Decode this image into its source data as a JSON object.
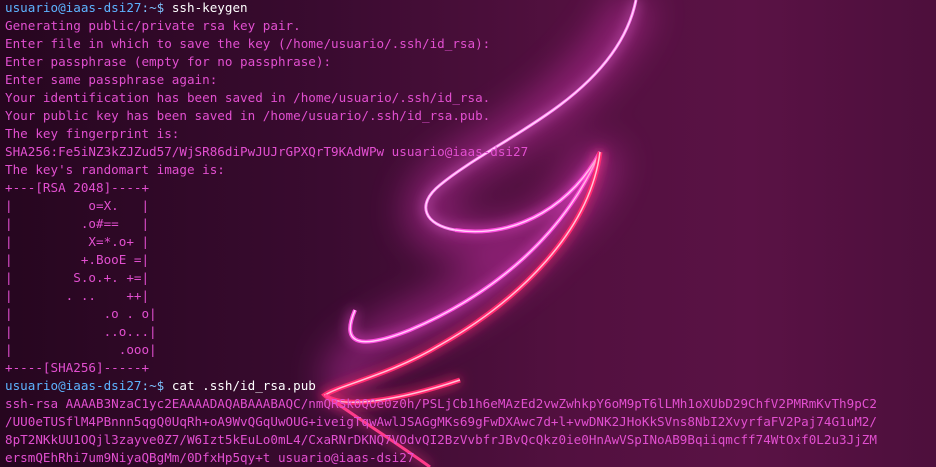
{
  "terminal": {
    "colors": {
      "background": "#3a0b30",
      "text": "#e24fd0",
      "prompt": "#5db3ff",
      "command": "#ffffff",
      "glow": "#ff55e6"
    },
    "session": [
      {
        "kind": "prompt",
        "user": "usuario@iaas-dsi27",
        "path": ":~$",
        "command": " ssh-keygen"
      },
      {
        "kind": "output",
        "text": "Generating public/private rsa key pair."
      },
      {
        "kind": "output",
        "text": "Enter file in which to save the key (/home/usuario/.ssh/id_rsa):"
      },
      {
        "kind": "output",
        "text": "Enter passphrase (empty for no passphrase):"
      },
      {
        "kind": "output",
        "text": "Enter same passphrase again:"
      },
      {
        "kind": "output",
        "text": "Your identification has been saved in /home/usuario/.ssh/id_rsa."
      },
      {
        "kind": "output",
        "text": "Your public key has been saved in /home/usuario/.ssh/id_rsa.pub."
      },
      {
        "kind": "output",
        "text": "The key fingerprint is:"
      },
      {
        "kind": "output",
        "text": "SHA256:Fe5iNZ3kZJZud57/WjSR86diPwJUJrGPXQrT9KAdWPw usuario@iaas-dsi27"
      },
      {
        "kind": "output",
        "text": "The key's randomart image is:"
      },
      {
        "kind": "output",
        "text": "+---[RSA 2048]----+"
      },
      {
        "kind": "output",
        "text": "|          o=X.   |"
      },
      {
        "kind": "output",
        "text": "|         .o#==   |"
      },
      {
        "kind": "output",
        "text": "|          X=*.o+ |"
      },
      {
        "kind": "output",
        "text": "|         +.BooE =|"
      },
      {
        "kind": "output",
        "text": "|        S.o.+. +=|"
      },
      {
        "kind": "output",
        "text": "|       . ..    ++|"
      },
      {
        "kind": "output",
        "text": "|            .o . o|"
      },
      {
        "kind": "output",
        "text": "|            ..o...|"
      },
      {
        "kind": "output",
        "text": "|              .ooo|"
      },
      {
        "kind": "output",
        "text": "+----[SHA256]-----+"
      },
      {
        "kind": "prompt",
        "user": "usuario@iaas-dsi27",
        "path": ":~$",
        "command": " cat .ssh/id_rsa.pub"
      },
      {
        "kind": "output",
        "text": "ssh-rsa AAAAB3NzaC1yc2EAAAADAQABAAABAQC/nmQRSk0QOe0z0h/PSLjCb1h6eMAzEd2vwZwhkpY6oM9pT6lLMh1oXUbD29ChfV2PMRmKvTh9pC2"
      },
      {
        "kind": "output",
        "text": "/UU0eTUSflM4PBnnn5qgQ0UqRh+oA9WvQGqUwOUG+iveigTqwAwlJSAGgMKs69gFwDXAwc7d+l+vwDNK2JHoKkSVns8NbI2XvyrfaFV2Paj74G1uM2/"
      },
      {
        "kind": "output",
        "text": "8pT2NKkUU1OQjl3zayve0Z7/W6Izt5kEuLo0mL4/CxaRNrDKNQ7VOdvQI2BzVvbfrJBvQcQkz0ie0HnAwVSpINoAB9Bqiiqmcff74WtOxf0L2u3JjZM"
      },
      {
        "kind": "output",
        "text": "ersmQEhRhi7um9NiyaQBgMm/0DfxHp5qy+t usuario@iaas-dsi27"
      }
    ]
  }
}
